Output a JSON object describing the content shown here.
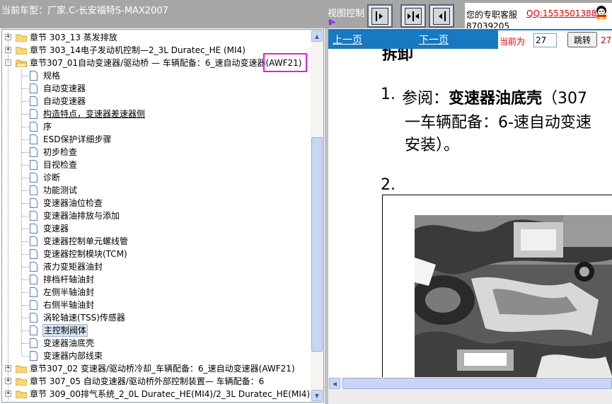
{
  "header": {
    "vehicle_title": "当前车型：厂家.C-长安福特S-MAX2007",
    "view_control_label": "视图控制",
    "view_buttons": [
      "expand-right",
      "split-view",
      "expand-left"
    ],
    "support": {
      "label": "您的专职客服",
      "qq": "QQ:1553501388",
      "phone": "87039205"
    }
  },
  "tree": {
    "top_items": [
      {
        "label": "章节  303_13 蒸发排放",
        "toggle": "+"
      },
      {
        "label": "章节  303_14电子发动机控制—2_3L Duratec_HE (MI4)",
        "toggle": "+"
      }
    ],
    "open_chapter": {
      "label_main": "章节307_01自动变速器/驱动桥 — 车辆配备：6_速自动变速器",
      "label_code": "(AWF21)",
      "toggle": "-"
    },
    "children": [
      "规格",
      "自动变速器",
      "自动变速器",
      "构造特点，变速器差速器侧",
      "序",
      "ESD保护详细步骤",
      "初步检查",
      "目视检查",
      "诊断",
      "功能测试",
      "变速器油位检查",
      "变速器油排放与添加",
      "变速器",
      "变速器控制单元螺线管",
      "变速器控制模块(TCM)",
      "液力变矩器油封",
      "排档杆轴油封",
      "左侧半轴油封",
      "右侧半轴油封",
      "涡轮轴速(TSS)传感器",
      "主控制阀体",
      "变速器油底壳",
      "变速器内部线束"
    ],
    "bottom_items": [
      {
        "label": "章节307_02 变速器/驱动桥冷却_车辆配备：6_速自动变速器(AWF21)",
        "toggle": "+"
      },
      {
        "label": "章节  307_05 自动变速器/驱动桥外部控制装置— 车辆配备：6",
        "toggle": "+"
      },
      {
        "label": "章节  309_00排气系统_2_0L Duratec_HE(MI4)/2_3L Duratec_HE(MI4)",
        "toggle": "+"
      }
    ]
  },
  "nav": {
    "prev": "上一页",
    "next": "下一页",
    "current_label": "当前为",
    "current_page": "27",
    "jump_button": "跳转",
    "total_page": "27"
  },
  "document": {
    "heading": "拆卸",
    "step1_number": "1.",
    "step1_prefix": "参阅：",
    "step1_bold": "变速器油底壳",
    "step1_suffix": "（307",
    "step1_line2": "一车辆配备：6-速自动变速",
    "step1_line3": "安装）。",
    "step2_number": "2."
  }
}
